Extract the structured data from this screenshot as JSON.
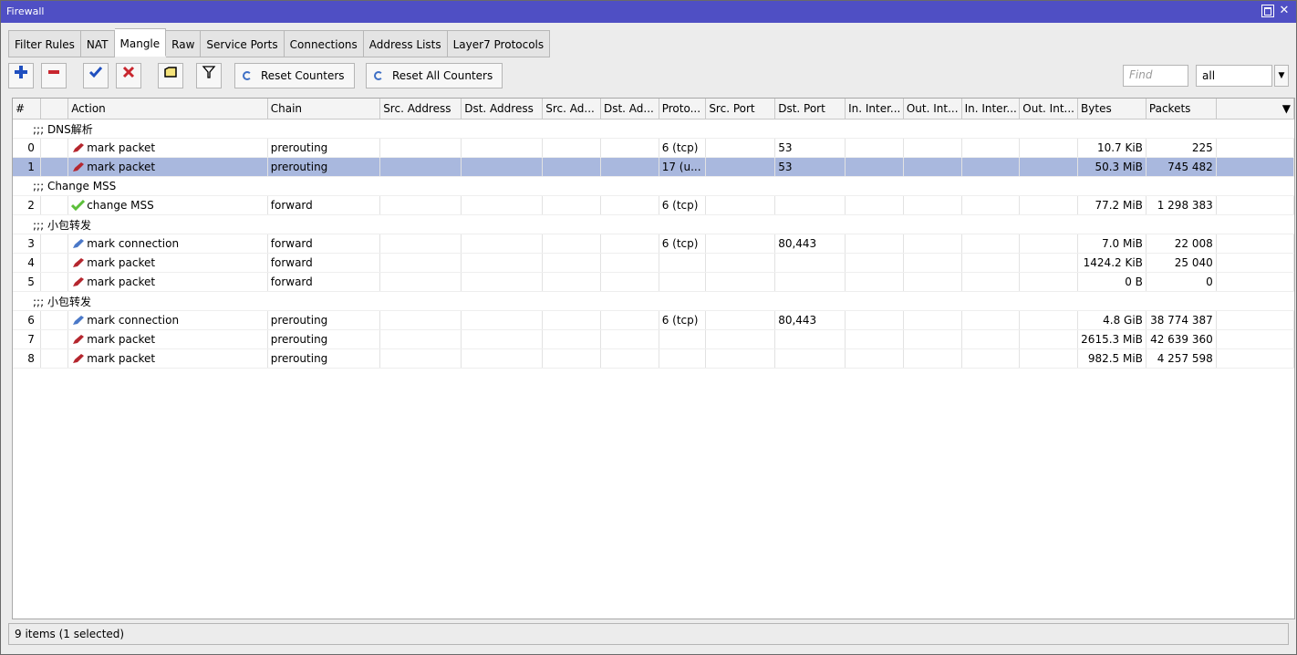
{
  "window": {
    "title": "Firewall"
  },
  "tabs": [
    {
      "label": "Filter Rules",
      "active": false
    },
    {
      "label": "NAT",
      "active": false
    },
    {
      "label": "Mangle",
      "active": true
    },
    {
      "label": "Raw",
      "active": false
    },
    {
      "label": "Service Ports",
      "active": false
    },
    {
      "label": "Connections",
      "active": false
    },
    {
      "label": "Address Lists",
      "active": false
    },
    {
      "label": "Layer7 Protocols",
      "active": false
    }
  ],
  "toolbar": {
    "add_icon": "plus-icon",
    "remove_icon": "minus-icon",
    "enable_icon": "check-icon",
    "disable_icon": "x-icon",
    "comment_icon": "note-icon",
    "filter_icon": "funnel-icon",
    "reset_counters": "Reset Counters",
    "reset_all_counters": "Reset All Counters",
    "find_placeholder": "Find",
    "filter_value": "all"
  },
  "columns": [
    "#",
    "",
    "Action",
    "Chain",
    "Src. Address",
    "Dst. Address",
    "Src. Ad...",
    "Dst. Ad...",
    "Proto...",
    "Src. Port",
    "Dst. Port",
    "In. Inter...",
    "Out. Int...",
    "In. Inter...",
    "Out. Int...",
    "Bytes",
    "Packets",
    ""
  ],
  "rows": [
    {
      "type": "comment",
      "text": ";;; DNS解析"
    },
    {
      "type": "rule",
      "index": "0",
      "icon": "red",
      "action": "mark packet",
      "chain": "prerouting",
      "proto": "6 (tcp)",
      "dst_port": "53",
      "bytes": "10.7 KiB",
      "packets": "225",
      "selected": false
    },
    {
      "type": "rule",
      "index": "1",
      "icon": "red",
      "action": "mark packet",
      "chain": "prerouting",
      "proto": "17 (u...",
      "dst_port": "53",
      "bytes": "50.3 MiB",
      "packets": "745 482",
      "selected": true
    },
    {
      "type": "comment",
      "text": ";;; Change MSS"
    },
    {
      "type": "rule",
      "index": "2",
      "icon": "green",
      "action": "change MSS",
      "chain": "forward",
      "proto": "6 (tcp)",
      "dst_port": "",
      "bytes": "77.2 MiB",
      "packets": "1 298 383",
      "selected": false
    },
    {
      "type": "comment",
      "text": ";;; 小包转发"
    },
    {
      "type": "rule",
      "index": "3",
      "icon": "blue",
      "action": "mark connection",
      "chain": "forward",
      "proto": "6 (tcp)",
      "dst_port": "80,443",
      "bytes": "7.0 MiB",
      "packets": "22 008",
      "selected": false
    },
    {
      "type": "rule",
      "index": "4",
      "icon": "red",
      "action": "mark packet",
      "chain": "forward",
      "proto": "",
      "dst_port": "",
      "bytes": "1424.2 KiB",
      "packets": "25 040",
      "selected": false
    },
    {
      "type": "rule",
      "index": "5",
      "icon": "red",
      "action": "mark packet",
      "chain": "forward",
      "proto": "",
      "dst_port": "",
      "bytes": "0 B",
      "packets": "0",
      "selected": false
    },
    {
      "type": "comment",
      "text": ";;; 小包转发"
    },
    {
      "type": "rule",
      "index": "6",
      "icon": "blue",
      "action": "mark connection",
      "chain": "prerouting",
      "proto": "6 (tcp)",
      "dst_port": "80,443",
      "bytes": "4.8 GiB",
      "packets": "38 774 387",
      "selected": false
    },
    {
      "type": "rule",
      "index": "7",
      "icon": "red",
      "action": "mark packet",
      "chain": "prerouting",
      "proto": "",
      "dst_port": "",
      "bytes": "2615.3 MiB",
      "packets": "42 639 360",
      "selected": false
    },
    {
      "type": "rule",
      "index": "8",
      "icon": "red",
      "action": "mark packet",
      "chain": "prerouting",
      "proto": "",
      "dst_port": "",
      "bytes": "982.5 MiB",
      "packets": "4 257 598",
      "selected": false
    }
  ],
  "icon_colors": {
    "red": "#b5262e",
    "green": "#5cbf3a",
    "blue": "#4a78c8",
    "selection": "#a9b8de",
    "title_bar": "#4f4fc4"
  },
  "status": {
    "text": "9 items (1 selected)"
  }
}
